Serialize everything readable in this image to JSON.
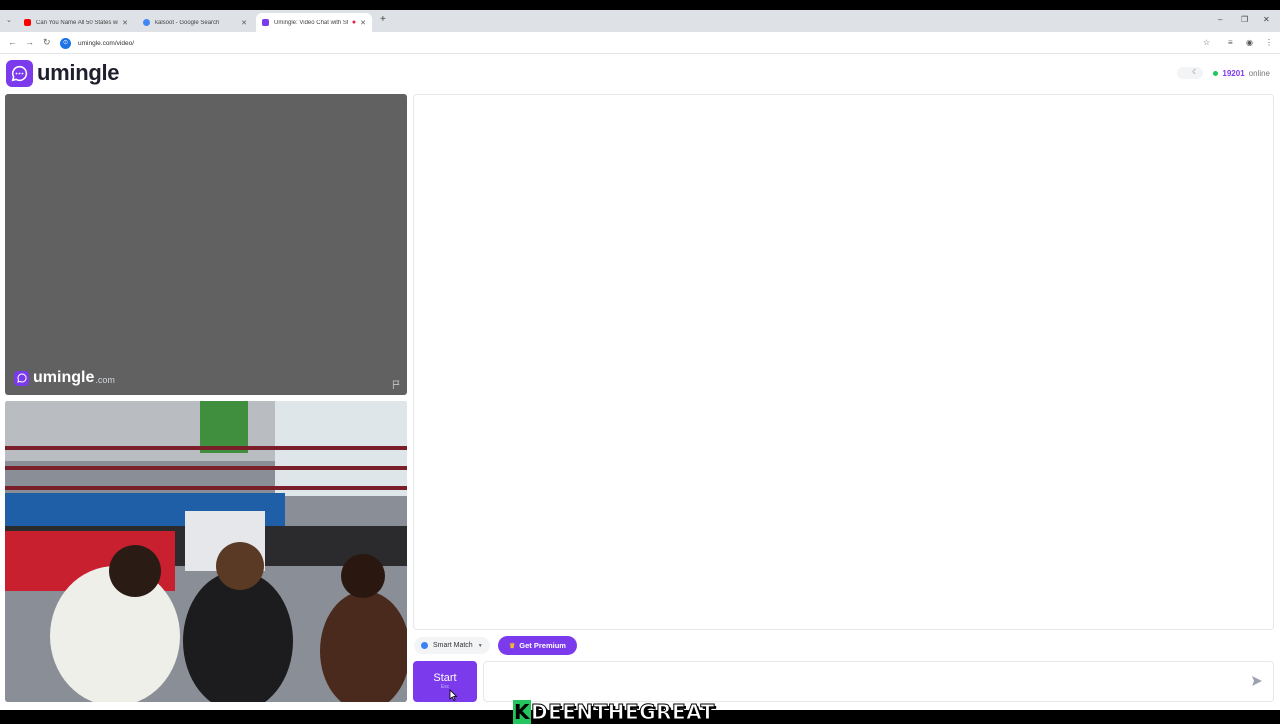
{
  "browser": {
    "tabs": [
      {
        "title": "Can You Name All 50 States wi",
        "favicon_color": "#ff0000"
      },
      {
        "title": "kalsoot - Google Search",
        "favicon_color": "#4285f4"
      },
      {
        "title": "Umingle: Video Chat with St",
        "favicon_color": "#7c3aed"
      }
    ],
    "url": "umingle.com/video/"
  },
  "header": {
    "logo_text": "umingle",
    "online_count": "19201",
    "online_label": "online"
  },
  "remote_video": {
    "watermark_name": "umingle",
    "watermark_domain": ".com"
  },
  "controls": {
    "smart_match": "Smart Match",
    "premium": "Get Premium",
    "start": "Start",
    "start_key": "Esc"
  },
  "overlay": {
    "streamer_tag_initial": "K",
    "streamer_tag": "DEENTHEGREAT"
  },
  "colors": {
    "brand": "#7c3aed",
    "online_dot": "#22c55e"
  }
}
